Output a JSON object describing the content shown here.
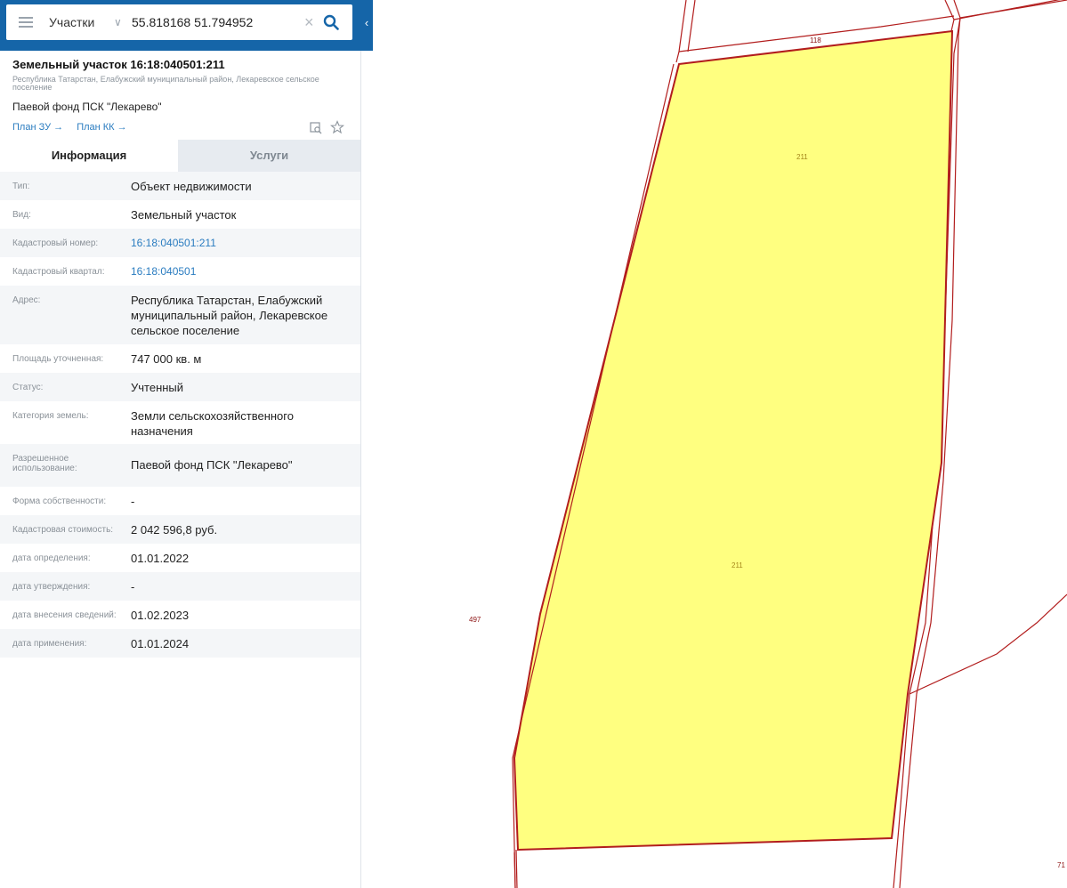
{
  "search": {
    "layer": "Участки",
    "query": "55.818168 51.794952"
  },
  "object": {
    "title": "Земельный участок 16:18:040501:211",
    "address_short": "Республика Татарстан, Елабужский муниципальный район, Лекаревское сельское поселение",
    "use": "Паевой фонд ПСК \"Лекарево\"",
    "links": [
      "План ЗУ →",
      "План КК →"
    ]
  },
  "tabs": [
    "Информация",
    "Услуги"
  ],
  "info": [
    {
      "label": "Тип:",
      "value": "Объект недвижимости"
    },
    {
      "label": "Вид:",
      "value": "Земельный участок"
    },
    {
      "label": "Кадастровый номер:",
      "value": "16:18:040501:211"
    },
    {
      "label": "Кадастровый квартал:",
      "value": "16:18:040501"
    },
    {
      "label": "Адрес:",
      "value": "Республика Татарстан, Елабужский муниципальный район, Лекаревское сельское поселение"
    },
    {
      "label": "Площадь уточненная:",
      "value": "747 000 кв. м"
    },
    {
      "label": "Статус:",
      "value": "Учтенный"
    },
    {
      "label": "Категория земель:",
      "value": "Земли сельскохозяйственного назначения"
    },
    {
      "label": "Разрешенное использование:",
      "value": "Паевой фонд ПСК \"Лекарево\""
    },
    {
      "label": "Форма собственности:",
      "value": "-"
    },
    {
      "label": "Кадастровая стоимость:",
      "value": "2 042 596,8 руб."
    },
    {
      "label": "дата определения:",
      "value": "01.01.2022"
    },
    {
      "label": "дата утверждения:",
      "value": "-"
    },
    {
      "label": "дата внесения сведений:",
      "value": "01.02.2023"
    },
    {
      "label": "дата применения:",
      "value": "01.01.2024"
    }
  ],
  "map": {
    "labels": {
      "top_parcel": "118",
      "parcel_upper": "211",
      "parcel_center": "211",
      "left_parcel": "497",
      "corner": "71"
    },
    "colors": {
      "parcel_fill": "#ffff80",
      "boundary": "#b21d1d"
    }
  }
}
